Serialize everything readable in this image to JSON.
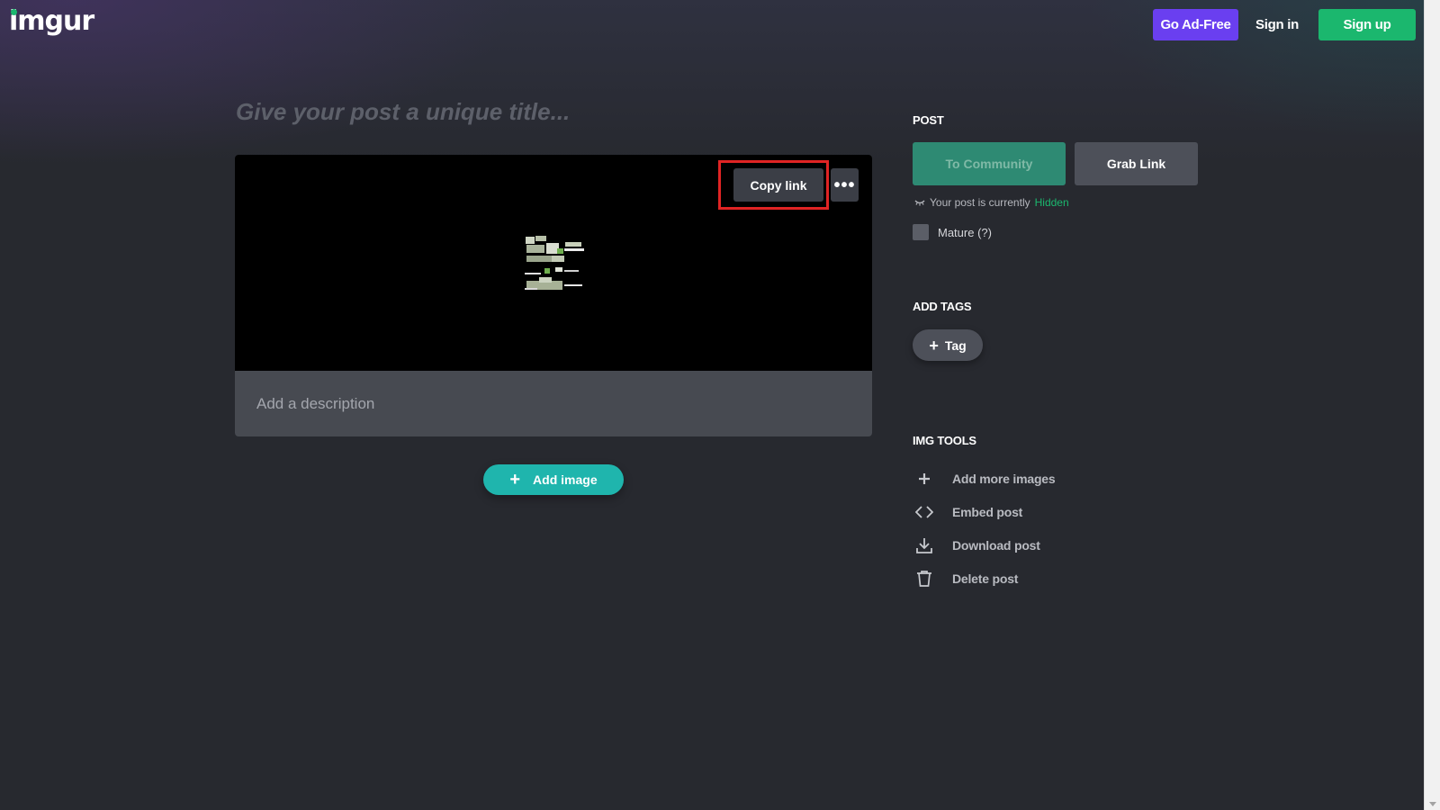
{
  "header": {
    "logo": "imgur",
    "go_ad_free": "Go Ad-Free",
    "sign_in": "Sign in",
    "sign_up": "Sign up"
  },
  "editor": {
    "title_placeholder": "Give your post a unique title...",
    "copy_link": "Copy link",
    "more_options": "•••",
    "description_placeholder": "Add a description",
    "add_image": "Add image",
    "add_image_icon": "+"
  },
  "sidebar": {
    "post_heading": "POST",
    "to_community": "To Community",
    "grab_link": "Grab Link",
    "status_prefix": "Your post is currently",
    "status_value": "Hidden",
    "mature_label": "Mature (?)",
    "tags_heading": "ADD TAGS",
    "tag_button": "Tag",
    "tag_button_icon": "+",
    "tools_heading": "IMG TOOLS",
    "tools": [
      {
        "label": "Add more images",
        "icon": "plus-icon"
      },
      {
        "label": "Embed post",
        "icon": "code-icon"
      },
      {
        "label": "Download post",
        "icon": "download-icon"
      },
      {
        "label": "Delete post",
        "icon": "trash-icon"
      }
    ]
  },
  "colors": {
    "background": "#27292f",
    "brand_green": "#1bb76e",
    "ad_free_purple": "#6a3ff0",
    "teal": "#1fb5ad",
    "highlight_red": "#e02424"
  }
}
